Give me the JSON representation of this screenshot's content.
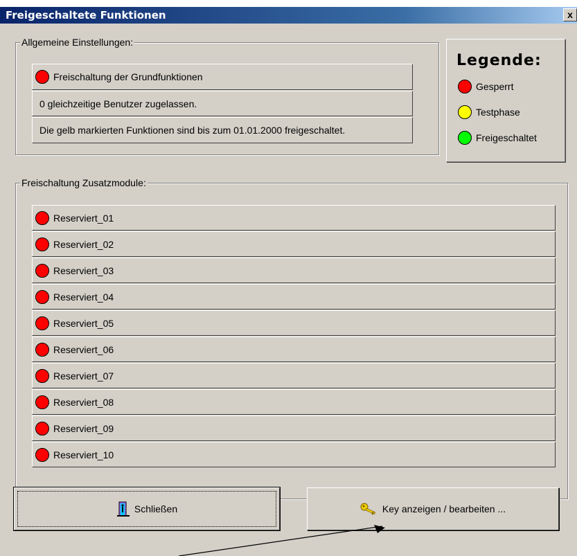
{
  "window": {
    "title": "Freigeschaltete Funktionen",
    "close_glyph": "x"
  },
  "general": {
    "label": "Allgemeine Einstellungen:",
    "basic_functions": {
      "label": "Freischaltung der Grundfunktionen",
      "status": "gesperrt"
    },
    "users": "0 gleichzeitige Benutzer zugelassen.",
    "note": "Die gelb markierten Funktionen sind bis zum 01.01.2000 freigeschaltet."
  },
  "legend": {
    "title": "Legende:",
    "items": [
      {
        "label": "Gesperrt",
        "color": "#ff0000"
      },
      {
        "label": "Testphase",
        "color": "#ffff00"
      },
      {
        "label": "Freigeschaltet",
        "color": "#00ff00"
      }
    ]
  },
  "modules": {
    "label": "Freischaltung Zusatzmodule:",
    "items": [
      {
        "label": "Reserviert_01",
        "status": "gesperrt"
      },
      {
        "label": "Reserviert_02",
        "status": "gesperrt"
      },
      {
        "label": "Reserviert_03",
        "status": "gesperrt"
      },
      {
        "label": "Reserviert_04",
        "status": "gesperrt"
      },
      {
        "label": "Reserviert_05",
        "status": "gesperrt"
      },
      {
        "label": "Reserviert_06",
        "status": "gesperrt"
      },
      {
        "label": "Reserviert_07",
        "status": "gesperrt"
      },
      {
        "label": "Reserviert_08",
        "status": "gesperrt"
      },
      {
        "label": "Reserviert_09",
        "status": "gesperrt"
      },
      {
        "label": "Reserviert_10",
        "status": "gesperrt"
      }
    ]
  },
  "buttons": {
    "close": {
      "label": "Schließen",
      "icon": "exit-door-icon"
    },
    "key": {
      "label": "Key anzeigen / bearbeiten ...",
      "icon": "key-icon"
    }
  },
  "colors": {
    "locked": "#ff0000",
    "trial": "#ffff00",
    "unlocked": "#00ff00"
  }
}
